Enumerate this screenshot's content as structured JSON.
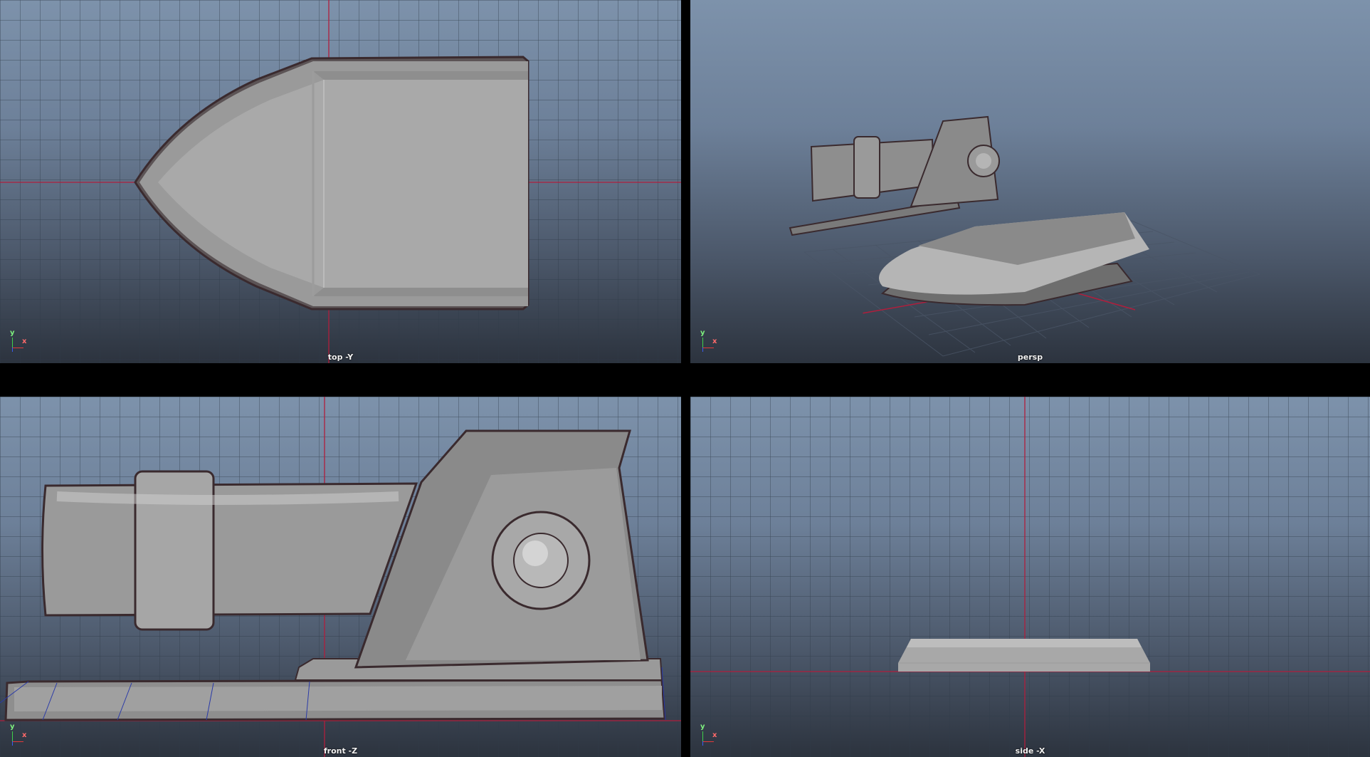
{
  "viewports": {
    "top": {
      "label": "top -Y",
      "camera": "top"
    },
    "persp": {
      "label": "persp",
      "camera": "perspective"
    },
    "front": {
      "label": "front -Z",
      "camera": "front"
    },
    "side": {
      "label": "side -X",
      "camera": "side"
    }
  },
  "axes": {
    "y": "y",
    "x": "x"
  },
  "colors": {
    "background_top": "#7d92ab",
    "background_bottom": "#2c333e",
    "grid_line": "#3a4656",
    "origin_axis": "#b01e3c",
    "model_gray": "#a8a8a8",
    "viewport_border": "#000000"
  }
}
